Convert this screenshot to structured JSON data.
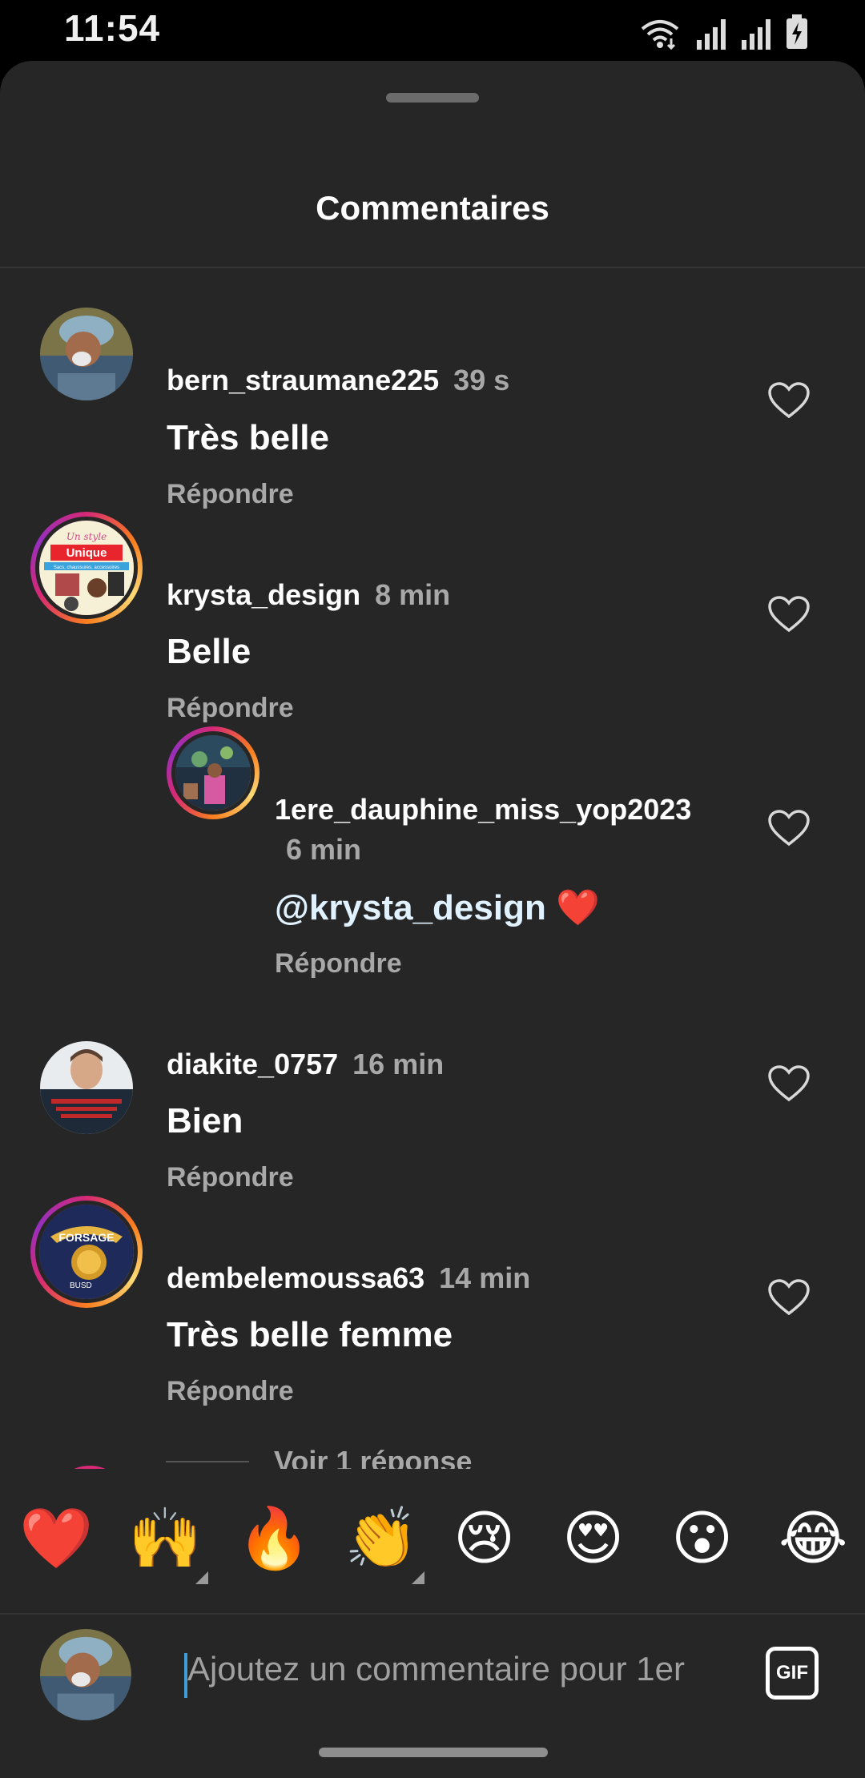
{
  "status_bar": {
    "time": "11:54"
  },
  "sheet": {
    "title": "Commentaires"
  },
  "comments": [
    {
      "username": "bern_straumane225",
      "time": "39 s",
      "text": "Très belle",
      "reply_label": "Répondre"
    },
    {
      "username": "krysta_design",
      "time": "8 min",
      "text": "Belle",
      "reply_label": "Répondre"
    },
    {
      "username": "1ere_dauphine_miss_yop2023",
      "time": "6 min",
      "mention": "@krysta_design",
      "text_suffix": "❤️",
      "reply_label": "Répondre"
    },
    {
      "username": "diakite_0757",
      "time": "16 min",
      "text": "Bien",
      "reply_label": "Répondre"
    },
    {
      "username": "dembelemoussa63",
      "time": "14 min",
      "text": "Très belle femme",
      "reply_label": "Répondre"
    }
  ],
  "view_replies": "Voir 1 réponse",
  "avatar_texts": {
    "krysta_design": {
      "line1": "Un style",
      "line2": "Unique",
      "line3": "Sacs, chaussures, accessoires"
    },
    "dembelemoussa63": {
      "line1": "FORSAGE",
      "line2": "BUSD"
    }
  },
  "emoji_bar": [
    "❤️",
    "🙌",
    "🔥",
    "👏",
    "😢",
    "😍",
    "😮",
    "😂"
  ],
  "composer": {
    "placeholder": "Ajoutez un commentaire pour 1er",
    "gif_label": "GIF"
  },
  "colors": {
    "background": "#262626",
    "secondary_text": "#a8a8a8",
    "mention": "#e0f1ff",
    "cursor": "#3f9dd8"
  }
}
